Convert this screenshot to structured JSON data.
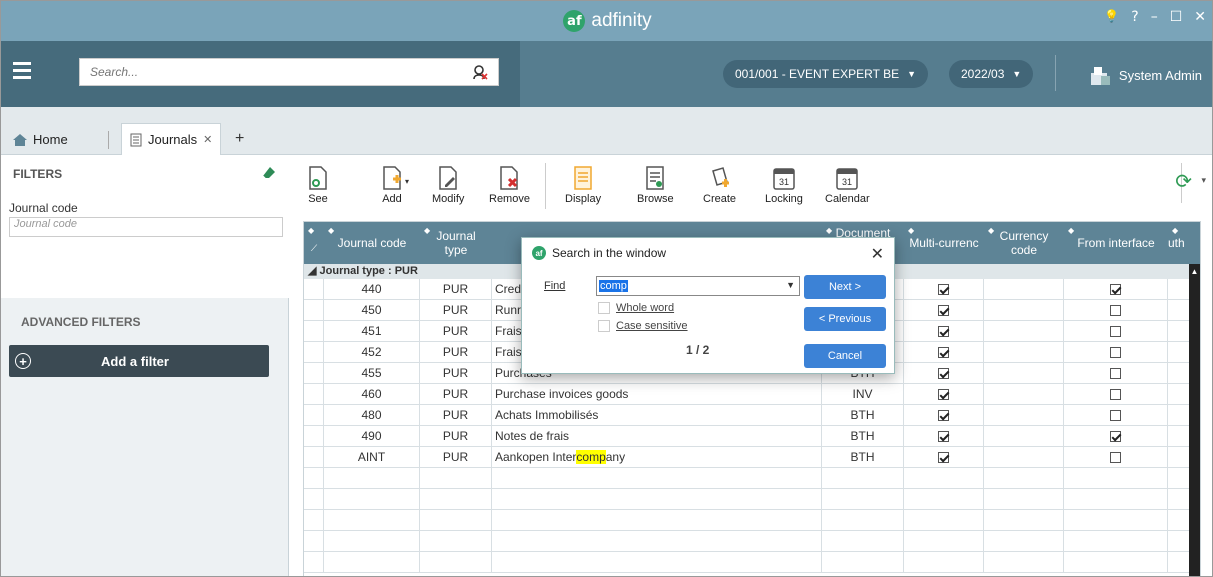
{
  "app": {
    "name": "adfinity",
    "logo_text": "af"
  },
  "window_controls": {
    "bulb": "💡",
    "help": "?",
    "minimize": "–",
    "maximize": "☐",
    "close": "✕"
  },
  "topbar": {
    "search_placeholder": "Search...",
    "company": "001/001 - EVENT EXPERT BE",
    "period": "2022/03",
    "user": "System Admin"
  },
  "tabs": {
    "home": "Home",
    "journals": "Journals",
    "add": "+"
  },
  "sidebar": {
    "filters_title": "FILTERS",
    "journal_code_label": "Journal code",
    "journal_code_placeholder": "Journal code",
    "advanced_title": "ADVANCED FILTERS",
    "add_filter": "Add a filter"
  },
  "toolbar": {
    "see": "See",
    "add": "Add",
    "modify": "Modify",
    "remove": "Remove",
    "display": "Display",
    "browse": "Browse",
    "create": "Create",
    "locking": "Locking",
    "calendar": "Calendar",
    "cal_num": "31"
  },
  "grid": {
    "headers": {
      "journal_code": "Journal code",
      "journal_type": "Journal type",
      "document": "Document",
      "multi_currency": "Multi-currenc",
      "currency_code": "Currency code",
      "from_interface": "From interface",
      "other": "uth"
    },
    "group_label": "◢ Journal type : PUR",
    "rows": [
      {
        "code": "440",
        "type": "PUR",
        "desc_pre": "Cred",
        "desc_hl": "",
        "desc_post": "",
        "doc": "",
        "multi": true,
        "iface": true
      },
      {
        "code": "450",
        "type": "PUR",
        "desc_pre": "Runr",
        "desc_hl": "",
        "desc_post": "",
        "doc": "",
        "multi": true,
        "iface": false
      },
      {
        "code": "451",
        "type": "PUR",
        "desc_pre": "Frais",
        "desc_hl": "",
        "desc_post": "",
        "doc": "",
        "multi": true,
        "iface": false
      },
      {
        "code": "452",
        "type": "PUR",
        "desc_pre": "Frais",
        "desc_hl": "",
        "desc_post": "",
        "doc": "",
        "multi": true,
        "iface": false
      },
      {
        "code": "455",
        "type": "PUR",
        "desc_pre": "Purchases",
        "desc_hl": "",
        "desc_post": "",
        "doc": "BTH",
        "multi": true,
        "iface": false
      },
      {
        "code": "460",
        "type": "PUR",
        "desc_pre": "Purchase invoices goods",
        "desc_hl": "",
        "desc_post": "",
        "doc": "INV",
        "multi": true,
        "iface": false
      },
      {
        "code": "480",
        "type": "PUR",
        "desc_pre": "Achats Immobilisés",
        "desc_hl": "",
        "desc_post": "",
        "doc": "BTH",
        "multi": true,
        "iface": false
      },
      {
        "code": "490",
        "type": "PUR",
        "desc_pre": "Notes de frais",
        "desc_hl": "",
        "desc_post": "",
        "doc": "BTH",
        "multi": true,
        "iface": true
      },
      {
        "code": "AINT",
        "type": "PUR",
        "desc_pre": "Aankopen Inter",
        "desc_hl": "comp",
        "desc_post": "any",
        "doc": "BTH",
        "multi": true,
        "iface": false
      }
    ]
  },
  "dialog": {
    "title": "Search in the window",
    "find_label": "Find",
    "find_value": "comp",
    "whole_word": "Whole word",
    "case_sensitive": "Case sensitive",
    "count": "1 / 2",
    "next": "Next >",
    "previous": "< Previous",
    "cancel": "Cancel"
  }
}
